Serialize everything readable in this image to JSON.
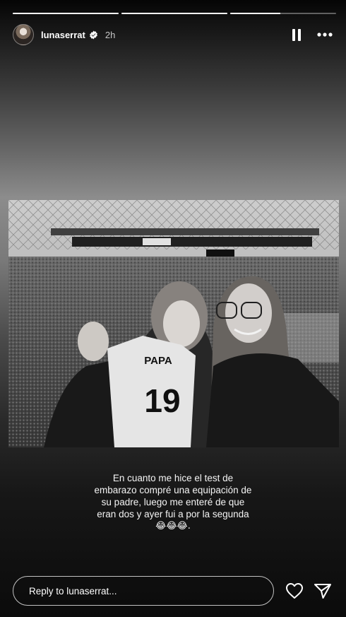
{
  "story": {
    "username": "lunaserrat",
    "time_ago": "2h",
    "verified": true,
    "progress_segments": [
      1,
      1,
      0.47
    ]
  },
  "caption": {
    "line1": "En cuanto me hice el test de",
    "line2": "embarazo compré una equipación de",
    "line3": "su padre, luego me enteré de que",
    "line4": "eran dos y ayer fui a por la segunda",
    "line5": "😂😂😂."
  },
  "photo": {
    "jersey_text": "PAPA",
    "jersey_number": "19"
  },
  "reply": {
    "placeholder": "Reply to lunaserrat..."
  },
  "icons": {
    "pause": "pause-icon",
    "more": "more-options-icon",
    "like": "heart-icon",
    "share": "send-icon",
    "verified": "verified-badge-icon"
  }
}
